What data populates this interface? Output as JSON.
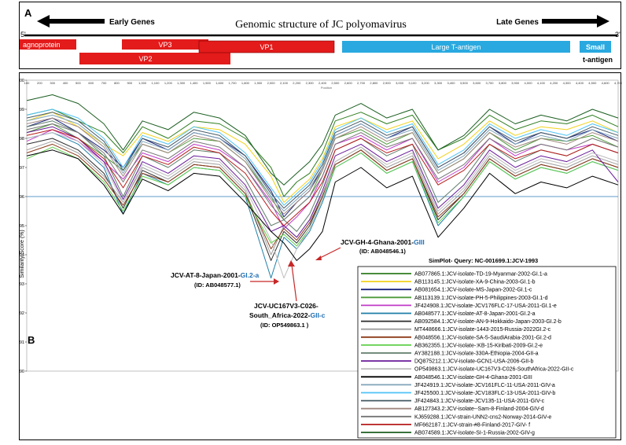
{
  "panel_a": {
    "label": "A",
    "title": "Genomic structure of JC polyomavirus",
    "early_label": "Early Genes",
    "late_label": "Late Genes",
    "five_prime": "5'",
    "three_prime": "3'",
    "genes": [
      {
        "name": "agnoprotein",
        "color": "#e31b1b"
      },
      {
        "name": "VP3",
        "color": "#e31b1b"
      },
      {
        "name": "VP2",
        "color": "#e31b1b"
      },
      {
        "name": "VP1",
        "color": "#e31b1b"
      },
      {
        "name": "Large T-antigen",
        "color": "#29a9df"
      },
      {
        "name": "Small",
        "color": "#29a9df"
      }
    ],
    "small_t_suffix": "t-antigen"
  },
  "panel_b": {
    "label": "B",
    "ylabel": "Similarity Score (%)",
    "xlabel": "Position",
    "annotations": [
      {
        "name": "JCV-GH-4-Ghana-2001-",
        "genotype": "GIII",
        "id": "(ID: AB048546.1)"
      },
      {
        "name": "JCV-AT-8-Japan-2001-",
        "genotype": "GI.2-a",
        "id": "(ID: AB048577.1)"
      },
      {
        "name": "JCV-UC167V3-C026-",
        "name2": "South_Africa-2022-",
        "genotype": "GII-c",
        "id": "(ID:  OP549863.1 )"
      }
    ],
    "legend_title": "SimPlot- Query: NC-001699.1:JCV-1993"
  },
  "chart_data": {
    "type": "line",
    "xlabel": "Position",
    "ylabel": "Similarity Score (%)",
    "ylim": [
      90,
      100
    ],
    "xlim": [
      100,
      4700
    ],
    "y_ticks": [
      90,
      91,
      92,
      93,
      94,
      95,
      96,
      97,
      98,
      99,
      100
    ],
    "x_ticks": [
      "100",
      "200",
      "300",
      "400",
      "500",
      "600",
      "700",
      "800",
      "900",
      "1,000",
      "1,100",
      "1,200",
      "1,300",
      "1,400",
      "1,500",
      "1,600",
      "1,700",
      "1,800",
      "1,900",
      "2,000",
      "2,100",
      "2,200",
      "2,300",
      "2,400",
      "2,500",
      "2,600",
      "2,700",
      "2,800",
      "2,900",
      "3,000",
      "3,100",
      "3,200",
      "3,300",
      "3,400",
      "3,500",
      "3,600",
      "3,700",
      "3,800",
      "3,900",
      "4,000",
      "4,100",
      "4,200",
      "4,300",
      "4,400",
      "4,500",
      "4,600",
      "4,700"
    ],
    "threshold": 96.0,
    "grid": false,
    "legend_position": "bottom-right",
    "x": [
      100,
      300,
      500,
      700,
      850,
      1000,
      1200,
      1400,
      1600,
      1800,
      2000,
      2100,
      2200,
      2300,
      2400,
      2500,
      2700,
      2900,
      3100,
      3300,
      3500,
      3700,
      3900,
      4100,
      4300,
      4500,
      4700
    ],
    "series": [
      {
        "name": "AB077865.1:JCV-isolate-TD-19-Myanmar-2002-GI.1-a",
        "color": "#2e7d1f",
        "values": [
          98.8,
          99.0,
          98.6,
          98.2,
          97.5,
          98.4,
          98.0,
          98.6,
          98.5,
          98.0,
          97.0,
          96.0,
          96.5,
          96.8,
          97.5,
          98.6,
          98.9,
          98.5,
          98.8,
          97.6,
          98.0,
          98.8,
          98.3,
          98.6,
          98.5,
          98.8,
          98.4
        ]
      },
      {
        "name": "AB113145.1:JCV-isolate-XA-9-China-2003-GI.1-b",
        "color": "#f2d21b",
        "values": [
          98.6,
          98.9,
          98.4,
          97.8,
          97.4,
          98.2,
          97.9,
          98.4,
          98.3,
          97.8,
          96.7,
          95.8,
          96.2,
          96.6,
          97.3,
          98.4,
          98.7,
          98.3,
          98.6,
          97.3,
          97.8,
          98.6,
          98.1,
          98.4,
          98.3,
          98.6,
          98.2
        ]
      },
      {
        "name": "AB081654.1:JCV-isolate-MS-Japan-2002-GI.1-c",
        "color": "#1a237e",
        "values": [
          98.4,
          98.7,
          98.2,
          97.6,
          97.0,
          98.0,
          97.6,
          98.2,
          98.0,
          97.4,
          96.2,
          95.3,
          95.8,
          96.2,
          97.0,
          98.1,
          98.5,
          98.0,
          98.4,
          97.0,
          97.5,
          98.4,
          97.8,
          98.2,
          98.0,
          98.3,
          97.9
        ]
      },
      {
        "name": "AB113139.1:JCV-isolate-PH-5-Philippines-2003-GI.1-d",
        "color": "#4e9a3a",
        "values": [
          98.2,
          98.5,
          98.0,
          97.4,
          96.9,
          97.8,
          97.5,
          98.0,
          97.9,
          97.2,
          96.0,
          95.2,
          95.6,
          96.0,
          96.9,
          98.0,
          98.3,
          97.8,
          98.2,
          96.8,
          97.3,
          98.2,
          97.6,
          98.0,
          97.9,
          98.1,
          97.7
        ]
      },
      {
        "name": "JF424908.1:JCV-isolate-JCV176FLC-17-USA-2011-GI.1-e",
        "color": "#c03ac8",
        "values": [
          97.9,
          98.3,
          97.9,
          97.2,
          96.6,
          97.5,
          97.2,
          97.8,
          97.6,
          97.0,
          95.8,
          94.9,
          95.3,
          95.8,
          96.7,
          97.8,
          98.1,
          97.6,
          98.0,
          96.5,
          97.0,
          98.0,
          97.4,
          97.8,
          97.6,
          97.8,
          97.5
        ]
      },
      {
        "name": "AB048577.1:JCV-isolate-AT-8-Japan-2001-GI.2-a",
        "color": "#1f7fa8",
        "values": [
          98.0,
          98.2,
          97.8,
          97.0,
          95.4,
          96.8,
          96.4,
          97.0,
          96.9,
          96.0,
          93.2,
          94.6,
          94.2,
          94.8,
          95.8,
          97.0,
          97.5,
          96.8,
          97.2,
          95.0,
          96.0,
          97.2,
          96.6,
          97.0,
          96.8,
          97.2,
          96.9
        ]
      },
      {
        "name": "AB092584.1:JCV-isolate-AN-9-Hokkaido-Japan-2003-GI.2-b",
        "color": "#2d2d2d",
        "values": [
          97.8,
          98.0,
          97.6,
          96.8,
          95.6,
          96.9,
          96.5,
          97.1,
          97.0,
          96.1,
          93.8,
          94.8,
          94.4,
          95.0,
          96.0,
          97.1,
          97.6,
          96.9,
          97.3,
          95.2,
          96.1,
          97.3,
          96.7,
          97.1,
          96.9,
          97.3,
          97.0
        ]
      },
      {
        "name": "MT448666.1:JCV-isolate-1443-2015-Russia-2022GI.2-c",
        "color": "#9e9e9e",
        "values": [
          97.6,
          97.9,
          97.5,
          96.7,
          95.8,
          97.0,
          96.6,
          97.2,
          97.1,
          96.2,
          94.0,
          95.0,
          94.6,
          95.2,
          96.1,
          97.2,
          97.7,
          97.0,
          97.4,
          95.4,
          96.2,
          97.4,
          96.8,
          97.2,
          97.0,
          97.4,
          97.1
        ]
      },
      {
        "name": "AB048556.1:JCV-isolate-SA-5-SaudiArabia-2001-GI.2-d",
        "color": "#8d3b1a",
        "values": [
          97.5,
          97.8,
          97.4,
          96.6,
          95.7,
          96.8,
          96.5,
          97.1,
          97.0,
          96.1,
          94.2,
          94.9,
          94.5,
          95.1,
          96.0,
          97.1,
          97.6,
          96.9,
          97.3,
          95.3,
          96.1,
          97.3,
          96.7,
          97.1,
          96.9,
          97.3,
          97.0
        ]
      },
      {
        "name": "AB362355.1:JCV-isolate-:KB-15-Kiribati-2009-GI.2-e",
        "color": "#5fcf4a",
        "values": [
          97.3,
          97.7,
          97.3,
          96.5,
          95.5,
          96.7,
          96.4,
          97.0,
          96.9,
          96.0,
          94.4,
          94.7,
          94.3,
          94.9,
          95.9,
          97.0,
          97.5,
          96.8,
          97.2,
          95.1,
          96.0,
          97.2,
          96.6,
          97.0,
          96.8,
          97.2,
          96.9
        ]
      },
      {
        "name": "AY382188.1:JCV-isolate-330A-Ethiopia-2004-GII-a",
        "color": "#607d6b",
        "values": [
          98.4,
          98.6,
          98.2,
          97.4,
          96.0,
          97.4,
          97.0,
          97.6,
          97.5,
          96.6,
          95.0,
          95.2,
          94.8,
          95.4,
          96.4,
          97.6,
          98.0,
          97.4,
          97.8,
          95.8,
          96.6,
          97.8,
          97.2,
          97.6,
          97.4,
          97.8,
          97.5
        ]
      },
      {
        "name": "DQ875212.1:JCV-isolate-GCN1-USA-2006-GII-b",
        "color": "#6a1b9a",
        "values": [
          98.2,
          98.4,
          98.0,
          97.2,
          95.9,
          97.2,
          96.8,
          97.4,
          97.3,
          96.4,
          94.8,
          95.0,
          94.6,
          95.2,
          96.2,
          97.4,
          97.8,
          97.2,
          97.6,
          95.6,
          96.4,
          97.6,
          97.0,
          97.4,
          97.2,
          97.6,
          96.5
        ]
      },
      {
        "name": "OP549863.1:JCV-isolate-UC167V3-C026-SouthAfrica-2022-GII-c",
        "color": "#bdbdbd",
        "values": [
          98.0,
          98.2,
          97.9,
          97.1,
          95.8,
          97.1,
          96.7,
          97.3,
          97.2,
          96.3,
          94.5,
          93.2,
          94.2,
          94.9,
          95.9,
          97.2,
          97.7,
          97.1,
          97.5,
          95.5,
          96.3,
          97.5,
          96.9,
          97.3,
          97.1,
          97.5,
          97.2
        ]
      },
      {
        "name": "AB048546.1:JCV-isolate-GH-4-Ghana-2001-GIII",
        "color": "#000000",
        "values": [
          97.4,
          97.6,
          97.3,
          96.4,
          95.4,
          96.6,
          96.2,
          96.8,
          96.7,
          95.8,
          94.8,
          94.4,
          93.8,
          94.2,
          94.8,
          96.5,
          97.0,
          96.3,
          96.7,
          94.6,
          95.6,
          96.8,
          96.1,
          96.5,
          96.3,
          96.7,
          96.4
        ]
      },
      {
        "name": "JF424919.1:JCV-isolate-JCV161FLC-11-USA-2011-GIV-a",
        "color": "#7fa3b8",
        "values": [
          98.6,
          98.8,
          98.5,
          97.8,
          96.8,
          97.9,
          97.6,
          98.2,
          98.0,
          97.3,
          96.0,
          95.5,
          95.9,
          96.3,
          97.0,
          98.1,
          98.5,
          98.0,
          98.3,
          96.9,
          97.4,
          98.3,
          97.8,
          98.1,
          97.9,
          98.3,
          98.0
        ]
      },
      {
        "name": "JF425500.1:JCV-isolate-JCV183FLC-13-USA-2011-GIV-b",
        "color": "#4fc3f7",
        "values": [
          98.8,
          99.0,
          98.7,
          98.0,
          97.0,
          98.1,
          97.8,
          98.4,
          98.2,
          97.5,
          96.3,
          95.7,
          96.1,
          96.5,
          97.2,
          98.3,
          98.7,
          98.2,
          98.5,
          97.1,
          97.6,
          98.5,
          98.0,
          98.3,
          98.1,
          98.5,
          98.2
        ]
      },
      {
        "name": "JF424843.1:JCV-isolate-JCV135-11-USA-2011-GIV-c",
        "color": "#455a64",
        "values": [
          98.7,
          98.9,
          98.6,
          97.9,
          96.9,
          98.0,
          97.7,
          98.3,
          98.1,
          97.4,
          96.1,
          95.6,
          96.0,
          96.4,
          97.1,
          98.2,
          98.6,
          98.1,
          98.4,
          97.0,
          97.5,
          98.4,
          97.9,
          98.2,
          98.0,
          98.4,
          98.1
        ]
      },
      {
        "name": "AB127343.2:JCV-isolate--Sam-8-Finland-2004-GIV-d",
        "color": "#a1887f",
        "values": [
          98.5,
          98.7,
          98.4,
          97.7,
          96.7,
          97.8,
          97.5,
          98.1,
          97.9,
          97.2,
          95.9,
          95.4,
          95.8,
          96.2,
          96.9,
          98.0,
          98.4,
          97.9,
          98.2,
          96.8,
          97.3,
          98.2,
          97.7,
          98.0,
          97.8,
          98.2,
          97.9
        ]
      },
      {
        "name": "KJ659288.1:JCV-strain-UNN2-cns2-Norway-2014-GIV-e",
        "color": "#757575",
        "values": [
          98.3,
          98.5,
          98.2,
          97.5,
          96.5,
          97.6,
          97.3,
          97.9,
          97.7,
          97.0,
          95.7,
          95.2,
          95.6,
          96.0,
          96.7,
          97.8,
          98.2,
          97.7,
          98.0,
          96.6,
          97.1,
          98.0,
          97.5,
          97.8,
          97.6,
          98.0,
          97.7
        ]
      },
      {
        "name": "MF662187.1:JCV-strain-#8-Finland-2017-GIV- f",
        "color": "#b71c1c",
        "values": [
          98.1,
          98.3,
          98.0,
          97.3,
          96.3,
          97.4,
          97.1,
          97.7,
          97.5,
          96.8,
          95.5,
          95.0,
          95.4,
          95.8,
          96.5,
          97.6,
          98.0,
          97.5,
          97.8,
          96.4,
          96.9,
          97.8,
          97.3,
          97.6,
          97.4,
          97.8,
          97.5
        ]
      },
      {
        "name": "AB074589.1:JCV-isolate-SI-1-Russia-2002-GIV-g",
        "color": "#1b5e20",
        "values": [
          99.3,
          99.5,
          99.2,
          98.5,
          97.6,
          98.6,
          98.3,
          98.9,
          98.7,
          98.1,
          96.8,
          96.4,
          96.8,
          97.2,
          97.8,
          98.8,
          99.2,
          98.7,
          99.0,
          97.6,
          98.1,
          99.0,
          98.5,
          98.8,
          98.6,
          99.0,
          98.7
        ]
      }
    ]
  }
}
